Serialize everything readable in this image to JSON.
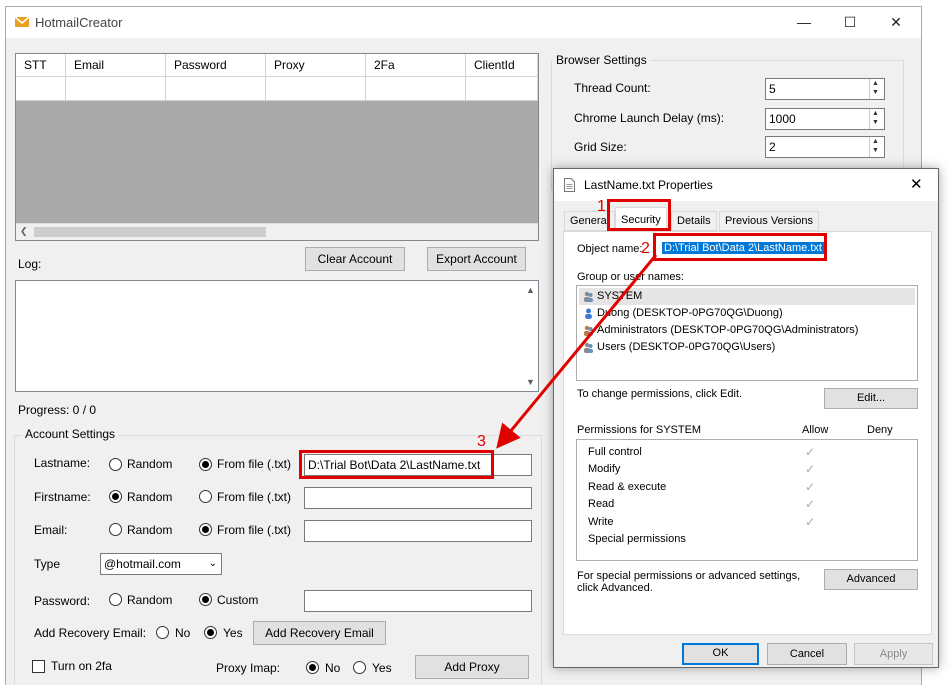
{
  "app": {
    "title": "HotmailCreator"
  },
  "grid": {
    "columns": [
      "STT",
      "Email",
      "Password",
      "Proxy",
      "2Fa",
      "ClientId"
    ]
  },
  "buttons": {
    "clear_account": "Clear Account",
    "export_account": "Export Account"
  },
  "log": {
    "label": "Log:"
  },
  "progress": {
    "label": "Progress: 0 / 0"
  },
  "account_settings": {
    "title": "Account Settings",
    "lastname": {
      "label": "Lastname:",
      "random": "Random",
      "from_file": "From file (.txt)",
      "value": "D:\\Trial Bot\\Data 2\\LastName.txt"
    },
    "firstname": {
      "label": "Firstname:",
      "random": "Random",
      "from_file": "From file (.txt)",
      "value": ""
    },
    "email": {
      "label": "Email:",
      "random": "Random",
      "from_file": "From file (.txt)",
      "value": ""
    },
    "type": {
      "label": "Type",
      "value": "@hotmail.com"
    },
    "password": {
      "label": "Password:",
      "random": "Random",
      "custom": "Custom",
      "value": ""
    },
    "recovery": {
      "label": "Add Recovery Email:",
      "no": "No",
      "yes": "Yes",
      "button": "Add Recovery Email"
    },
    "twofa": {
      "label": "Turn on 2fa"
    },
    "proxy_imap": {
      "label": "Proxy Imap:",
      "no": "No",
      "yes": "Yes",
      "button": "Add Proxy"
    }
  },
  "browser_settings": {
    "title": "Browser Settings",
    "thread_count": {
      "label": "Thread Count:",
      "value": "5"
    },
    "launch_delay": {
      "label": "Chrome Launch Delay (ms):",
      "value": "1000"
    },
    "grid_size": {
      "label": "Grid Size:",
      "value": "2"
    }
  },
  "properties": {
    "title": "LastName.txt Properties",
    "tabs": [
      "General",
      "Security",
      "Details",
      "Previous Versions"
    ],
    "object_name_label": "Object name:",
    "object_name_value": "D:\\Trial Bot\\Data 2\\LastName.txt",
    "group_label": "Group or user names:",
    "users": [
      "SYSTEM",
      "Duong (DESKTOP-0PG70QG\\Duong)",
      "Administrators (DESKTOP-0PG70QG\\Administrators)",
      "Users (DESKTOP-0PG70QG\\Users)"
    ],
    "change_perm_text": "To change permissions, click Edit.",
    "edit_button": "Edit...",
    "perm_header": "Permissions for SYSTEM",
    "allow": "Allow",
    "deny": "Deny",
    "permissions": [
      "Full control",
      "Modify",
      "Read & execute",
      "Read",
      "Write",
      "Special permissions"
    ],
    "special_text_1": "For special permissions or advanced settings,",
    "special_text_2": "click Advanced.",
    "advanced_button": "Advanced",
    "ok": "OK",
    "cancel": "Cancel",
    "apply": "Apply"
  },
  "annotations": {
    "step1": "1",
    "step2": "2",
    "step3": "3"
  },
  "colors": {
    "annotation": "#e00000",
    "selection": "#0078d7"
  }
}
